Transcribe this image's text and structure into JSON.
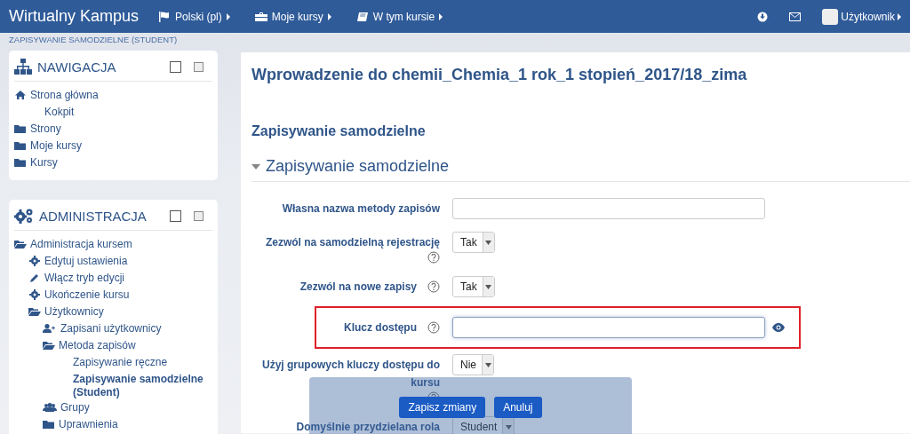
{
  "navbar": {
    "brand": "Wirtualny Kampus",
    "menus": [
      {
        "kind": "flag",
        "label": "Polski (pl)"
      },
      {
        "kind": "briefcase",
        "label": "Moje kursy"
      },
      {
        "kind": "book",
        "label": "W tym kursie"
      }
    ],
    "user": "Użytkownik"
  },
  "breadcrumb": "ZAPISYWANIE SAMODZIELNE (STUDENT)",
  "blocks": [
    {
      "kind": "sitemap",
      "title": "NAWIGACJA",
      "items": [
        {
          "kind": "home",
          "label": "Strona główna",
          "selected": false,
          "children": [
            {
              "kind": "none",
              "label": "Kokpit",
              "selected": false
            }
          ]
        },
        {
          "kind": "folder",
          "label": "Strony",
          "selected": false
        },
        {
          "kind": "folder",
          "label": "Moje kursy",
          "selected": false
        },
        {
          "kind": "folder",
          "label": "Kursy",
          "selected": false
        }
      ]
    },
    {
      "kind": "gears",
      "title": "ADMINISTRACJA",
      "items": [
        {
          "kind": "folder-open",
          "label": "Administracja kursem",
          "selected": false,
          "children": [
            {
              "kind": "gear",
              "label": "Edytuj ustawienia",
              "selected": false
            },
            {
              "kind": "pencil",
              "label": "Włącz tryb edycji",
              "selected": false
            },
            {
              "kind": "gear",
              "label": "Ukończenie kursu",
              "selected": false
            },
            {
              "kind": "folder-open",
              "label": "Użytkownicy",
              "selected": false,
              "children": [
                {
                  "kind": "user-plus",
                  "label": "Zapisani użytkownicy",
                  "selected": false
                },
                {
                  "kind": "folder-open",
                  "label": "Metoda zapisów",
                  "selected": false,
                  "children": [
                    {
                      "kind": "none",
                      "label": "Zapisywanie ręczne",
                      "selected": false
                    },
                    {
                      "kind": "none",
                      "label": "Zapisywanie samodzielne (Student)",
                      "selected": true
                    }
                  ]
                },
                {
                  "kind": "users",
                  "label": "Grupy",
                  "selected": false
                },
                {
                  "kind": "folder",
                  "label": "Uprawnienia",
                  "selected": false
                }
              ]
            }
          ]
        }
      ]
    }
  ],
  "course_title": "Wprowadzenie do chemii_Chemia_1 rok_1 stopień_2017/18_zima",
  "page_heading": "Zapisywanie samodzielne",
  "fieldset": {
    "legend": "Zapisywanie samodzielne",
    "expanded": true,
    "fields": [
      {
        "kind": "text",
        "label": "Własna nazwa metody zapisów",
        "help": false,
        "highlighted": false
      },
      {
        "kind": "select",
        "label": "Zezwól na samodzielną rejestrację",
        "help": true,
        "highlighted": false,
        "value": "Tak"
      },
      {
        "kind": "select",
        "label": "Zezwól na nowe zapisy",
        "help": true,
        "highlighted": false,
        "value": "Tak"
      },
      {
        "kind": "password",
        "label": "Klucz dostępu",
        "help": true,
        "highlighted": true
      },
      {
        "kind": "select",
        "label": "Użyj grupowych kluczy dostępu do kursu",
        "help": true,
        "highlighted": false,
        "value": "Nie"
      },
      {
        "kind": "select",
        "label": "Domyślnie przydzielana rola",
        "help": false,
        "highlighted": false,
        "value": "Student"
      }
    ]
  },
  "actions": {
    "save": "Zapisz zmiany",
    "cancel": "Anuluj"
  }
}
